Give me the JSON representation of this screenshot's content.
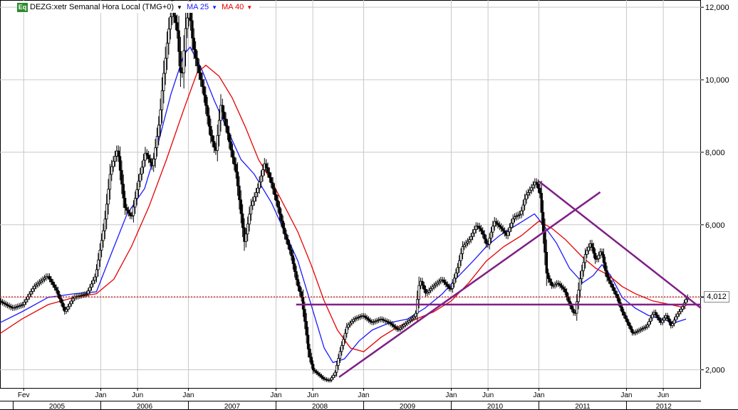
{
  "header": {
    "badge": "Eq",
    "title": "DEZG:xetr Semanal Hora Local (TMG+0)",
    "ma25_label": "MA 25",
    "ma40_label": "MA 40"
  },
  "last_value_label": "4,012",
  "colors": {
    "candle": "#000000",
    "ma25": "#1a1aff",
    "ma40": "#e60000",
    "trendline": "#7f1f86",
    "level": "#cc0000",
    "grid": "#c8c8c8"
  },
  "chart_data": {
    "type": "line",
    "subtype": "weekly candlestick with moving averages",
    "ylim": [
      1.5,
      12.2
    ],
    "y_ticks": [
      {
        "value": 2,
        "label": "2,000"
      },
      {
        "value": 4,
        "label": "4,000"
      },
      {
        "value": 6,
        "label": "6,000"
      },
      {
        "value": 8,
        "label": "8,000"
      },
      {
        "value": 10,
        "label": "10,000"
      },
      {
        "value": 12,
        "label": "12,000"
      }
    ],
    "x_range": [
      2004.85,
      2012.85
    ],
    "month_ticks": [
      {
        "x": 2005.12,
        "label": "Fev"
      },
      {
        "x": 2006.0,
        "label": "Jan"
      },
      {
        "x": 2006.42,
        "label": "Jun"
      },
      {
        "x": 2007.0,
        "label": "Jan"
      },
      {
        "x": 2008.0,
        "label": "Jan"
      },
      {
        "x": 2008.42,
        "label": "Jun"
      },
      {
        "x": 2009.0,
        "label": "Jan"
      },
      {
        "x": 2010.0,
        "label": "Jan"
      },
      {
        "x": 2010.42,
        "label": "Jun"
      },
      {
        "x": 2011.0,
        "label": "Jan"
      },
      {
        "x": 2012.0,
        "label": "Jan"
      },
      {
        "x": 2012.42,
        "label": "Jun"
      }
    ],
    "year_ticks": [
      {
        "x": 2005.0,
        "label": "2005"
      },
      {
        "x": 2006.0,
        "label": "2006"
      },
      {
        "x": 2007.0,
        "label": "2007"
      },
      {
        "x": 2008.0,
        "label": "2008"
      },
      {
        "x": 2009.0,
        "label": "2009"
      },
      {
        "x": 2010.0,
        "label": "2010"
      },
      {
        "x": 2011.0,
        "label": "2011"
      },
      {
        "x": 2012.0,
        "label": "2012"
      }
    ],
    "grid": true,
    "series": [
      {
        "name": "DEZG:xetr",
        "style": "candlestick",
        "points": [
          [
            2004.85,
            3.9
          ],
          [
            2005.0,
            3.7
          ],
          [
            2005.12,
            3.8
          ],
          [
            2005.25,
            4.3
          ],
          [
            2005.4,
            4.6
          ],
          [
            2005.5,
            4.2
          ],
          [
            2005.6,
            3.6
          ],
          [
            2005.7,
            4.0
          ],
          [
            2005.85,
            4.1
          ],
          [
            2005.95,
            4.6
          ],
          [
            2006.05,
            6.0
          ],
          [
            2006.12,
            7.5
          ],
          [
            2006.2,
            8.1
          ],
          [
            2006.28,
            6.5
          ],
          [
            2006.36,
            6.2
          ],
          [
            2006.44,
            7.2
          ],
          [
            2006.52,
            8.0
          ],
          [
            2006.6,
            7.6
          ],
          [
            2006.68,
            8.9
          ],
          [
            2006.72,
            10.0
          ],
          [
            2006.78,
            11.3
          ],
          [
            2006.82,
            12.0
          ],
          [
            2006.88,
            11.4
          ],
          [
            2006.93,
            9.9
          ],
          [
            2006.98,
            11.5
          ],
          [
            2007.02,
            12.0
          ],
          [
            2007.06,
            11.0
          ],
          [
            2007.1,
            10.5
          ],
          [
            2007.18,
            9.7
          ],
          [
            2007.26,
            8.5
          ],
          [
            2007.32,
            8.0
          ],
          [
            2007.38,
            9.3
          ],
          [
            2007.45,
            8.6
          ],
          [
            2007.5,
            8.0
          ],
          [
            2007.55,
            7.5
          ],
          [
            2007.6,
            6.5
          ],
          [
            2007.65,
            5.5
          ],
          [
            2007.72,
            6.5
          ],
          [
            2007.8,
            7.0
          ],
          [
            2007.88,
            7.7
          ],
          [
            2007.95,
            7.2
          ],
          [
            2008.02,
            6.6
          ],
          [
            2008.1,
            5.8
          ],
          [
            2008.18,
            5.2
          ],
          [
            2008.25,
            4.4
          ],
          [
            2008.3,
            4.0
          ],
          [
            2008.34,
            3.3
          ],
          [
            2008.38,
            2.5
          ],
          [
            2008.43,
            2.0
          ],
          [
            2008.48,
            1.9
          ],
          [
            2008.55,
            1.75
          ],
          [
            2008.62,
            1.7
          ],
          [
            2008.68,
            1.9
          ],
          [
            2008.74,
            2.5
          ],
          [
            2008.82,
            3.2
          ],
          [
            2008.9,
            3.4
          ],
          [
            2009.0,
            3.5
          ],
          [
            2009.1,
            3.3
          ],
          [
            2009.2,
            3.4
          ],
          [
            2009.3,
            3.3
          ],
          [
            2009.4,
            3.1
          ],
          [
            2009.5,
            3.3
          ],
          [
            2009.6,
            3.5
          ],
          [
            2009.65,
            4.5
          ],
          [
            2009.72,
            4.1
          ],
          [
            2009.8,
            4.3
          ],
          [
            2009.9,
            4.5
          ],
          [
            2010.0,
            4.2
          ],
          [
            2010.08,
            4.8
          ],
          [
            2010.14,
            5.4
          ],
          [
            2010.22,
            5.6
          ],
          [
            2010.3,
            6.0
          ],
          [
            2010.36,
            5.8
          ],
          [
            2010.42,
            5.4
          ],
          [
            2010.5,
            6.1
          ],
          [
            2010.58,
            5.9
          ],
          [
            2010.64,
            5.7
          ],
          [
            2010.72,
            6.2
          ],
          [
            2010.8,
            6.3
          ],
          [
            2010.86,
            6.8
          ],
          [
            2010.92,
            7.0
          ],
          [
            2010.97,
            7.2
          ],
          [
            2011.02,
            6.9
          ],
          [
            2011.06,
            5.8
          ],
          [
            2011.1,
            4.6
          ],
          [
            2011.16,
            4.3
          ],
          [
            2011.22,
            4.4
          ],
          [
            2011.3,
            4.2
          ],
          [
            2011.36,
            3.8
          ],
          [
            2011.42,
            3.5
          ],
          [
            2011.48,
            4.5
          ],
          [
            2011.54,
            5.2
          ],
          [
            2011.6,
            5.5
          ],
          [
            2011.66,
            5.0
          ],
          [
            2011.72,
            5.3
          ],
          [
            2011.78,
            4.6
          ],
          [
            2011.84,
            4.3
          ],
          [
            2011.9,
            4.0
          ],
          [
            2011.96,
            3.6
          ],
          [
            2012.02,
            3.3
          ],
          [
            2012.08,
            3.0
          ],
          [
            2012.16,
            3.1
          ],
          [
            2012.24,
            3.2
          ],
          [
            2012.32,
            3.6
          ],
          [
            2012.4,
            3.3
          ],
          [
            2012.46,
            3.5
          ],
          [
            2012.52,
            3.2
          ],
          [
            2012.58,
            3.5
          ],
          [
            2012.64,
            3.7
          ],
          [
            2012.7,
            4.0
          ]
        ]
      },
      {
        "name": "MA 25",
        "style": "line",
        "color": "#1a1aff",
        "points": [
          [
            2004.85,
            3.3
          ],
          [
            2005.1,
            3.6
          ],
          [
            2005.4,
            4.0
          ],
          [
            2005.7,
            4.1
          ],
          [
            2005.95,
            4.15
          ],
          [
            2006.12,
            5.2
          ],
          [
            2006.3,
            6.3
          ],
          [
            2006.5,
            7.0
          ],
          [
            2006.65,
            8.2
          ],
          [
            2006.8,
            9.6
          ],
          [
            2006.95,
            10.7
          ],
          [
            2007.02,
            10.9
          ],
          [
            2007.15,
            10.3
          ],
          [
            2007.3,
            9.4
          ],
          [
            2007.45,
            8.6
          ],
          [
            2007.6,
            7.8
          ],
          [
            2007.75,
            7.4
          ],
          [
            2007.95,
            6.6
          ],
          [
            2008.1,
            5.8
          ],
          [
            2008.25,
            5.0
          ],
          [
            2008.4,
            3.8
          ],
          [
            2008.55,
            2.6
          ],
          [
            2008.65,
            2.2
          ],
          [
            2008.78,
            2.3
          ],
          [
            2008.95,
            2.8
          ],
          [
            2009.1,
            3.1
          ],
          [
            2009.3,
            3.3
          ],
          [
            2009.5,
            3.4
          ],
          [
            2009.7,
            3.7
          ],
          [
            2009.9,
            4.1
          ],
          [
            2010.05,
            4.5
          ],
          [
            2010.25,
            5.0
          ],
          [
            2010.4,
            5.4
          ],
          [
            2010.55,
            5.7
          ],
          [
            2010.75,
            6.0
          ],
          [
            2010.95,
            6.3
          ],
          [
            2011.05,
            6.0
          ],
          [
            2011.2,
            5.5
          ],
          [
            2011.35,
            4.8
          ],
          [
            2011.5,
            4.4
          ],
          [
            2011.62,
            4.6
          ],
          [
            2011.72,
            4.9
          ],
          [
            2011.82,
            4.6
          ],
          [
            2011.95,
            4.0
          ],
          [
            2012.1,
            3.7
          ],
          [
            2012.25,
            3.5
          ],
          [
            2012.4,
            3.4
          ],
          [
            2012.55,
            3.3
          ],
          [
            2012.68,
            3.4
          ]
        ]
      },
      {
        "name": "MA 40",
        "style": "line",
        "color": "#e60000",
        "points": [
          [
            2004.85,
            3.0
          ],
          [
            2005.1,
            3.4
          ],
          [
            2005.4,
            3.8
          ],
          [
            2005.7,
            4.0
          ],
          [
            2005.95,
            4.1
          ],
          [
            2006.15,
            4.5
          ],
          [
            2006.35,
            5.4
          ],
          [
            2006.55,
            6.5
          ],
          [
            2006.75,
            7.8
          ],
          [
            2006.95,
            9.2
          ],
          [
            2007.1,
            10.2
          ],
          [
            2007.2,
            10.4
          ],
          [
            2007.35,
            10.1
          ],
          [
            2007.5,
            9.5
          ],
          [
            2007.65,
            8.7
          ],
          [
            2007.8,
            7.8
          ],
          [
            2007.95,
            7.2
          ],
          [
            2008.1,
            6.5
          ],
          [
            2008.25,
            5.8
          ],
          [
            2008.4,
            4.9
          ],
          [
            2008.55,
            3.9
          ],
          [
            2008.7,
            3.1
          ],
          [
            2008.85,
            2.6
          ],
          [
            2009.0,
            2.5
          ],
          [
            2009.2,
            2.9
          ],
          [
            2009.4,
            3.2
          ],
          [
            2009.6,
            3.4
          ],
          [
            2009.8,
            3.6
          ],
          [
            2010.0,
            3.9
          ],
          [
            2010.2,
            4.4
          ],
          [
            2010.4,
            5.0
          ],
          [
            2010.6,
            5.4
          ],
          [
            2010.8,
            5.7
          ],
          [
            2011.0,
            6.1
          ],
          [
            2011.15,
            5.9
          ],
          [
            2011.3,
            5.6
          ],
          [
            2011.5,
            5.1
          ],
          [
            2011.65,
            4.8
          ],
          [
            2011.8,
            4.6
          ],
          [
            2011.95,
            4.3
          ],
          [
            2012.1,
            4.1
          ],
          [
            2012.3,
            3.9
          ],
          [
            2012.5,
            3.8
          ],
          [
            2012.68,
            3.7
          ]
        ]
      }
    ],
    "annotations": {
      "horizontal_level": 4.012,
      "support_line": 3.8,
      "trendlines": [
        {
          "from": [
            2008.72,
            1.8
          ],
          "to": [
            2011.7,
            6.9
          ]
        },
        {
          "from": [
            2011.0,
            7.2
          ],
          "to": [
            2012.85,
            3.7
          ]
        }
      ]
    }
  }
}
